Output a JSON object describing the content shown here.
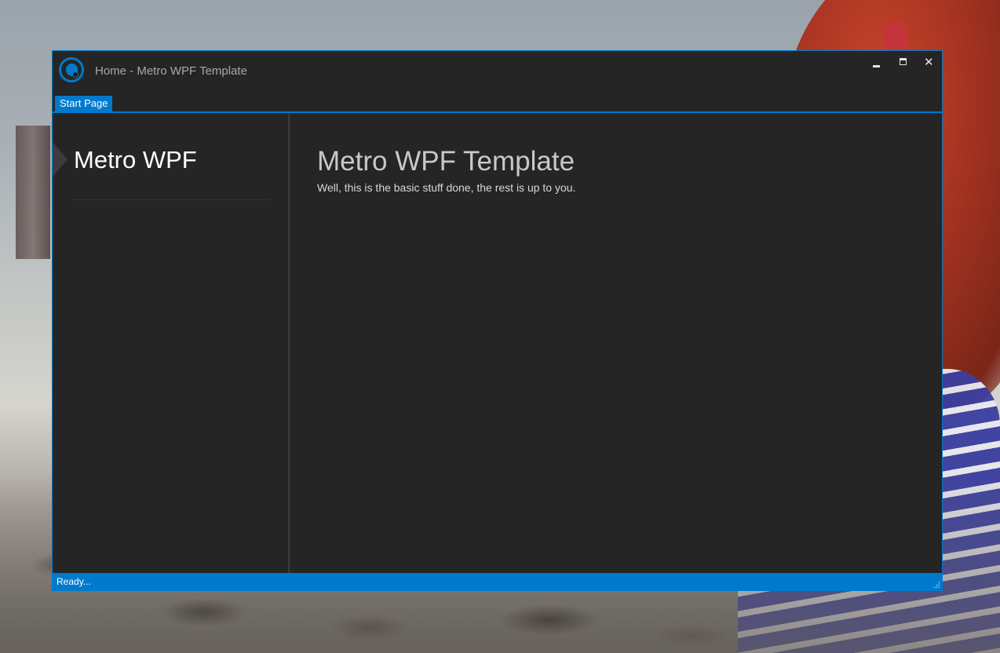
{
  "window": {
    "title": "Home - Metro WPF Template",
    "accent_color": "#007acc",
    "background_color": "#252526",
    "controls": {
      "minimize_icon": "minimize-icon",
      "maximize_icon": "maximize-icon",
      "close_glyph": "✕"
    }
  },
  "tabs": [
    {
      "label": "Start Page",
      "selected": true
    }
  ],
  "sidebar": {
    "heading": "Metro WPF"
  },
  "content": {
    "title": "Metro WPF Template",
    "subtitle": "Well, this is the basic stuff done, the rest is up to you."
  },
  "status_bar": {
    "text": "Ready..."
  }
}
